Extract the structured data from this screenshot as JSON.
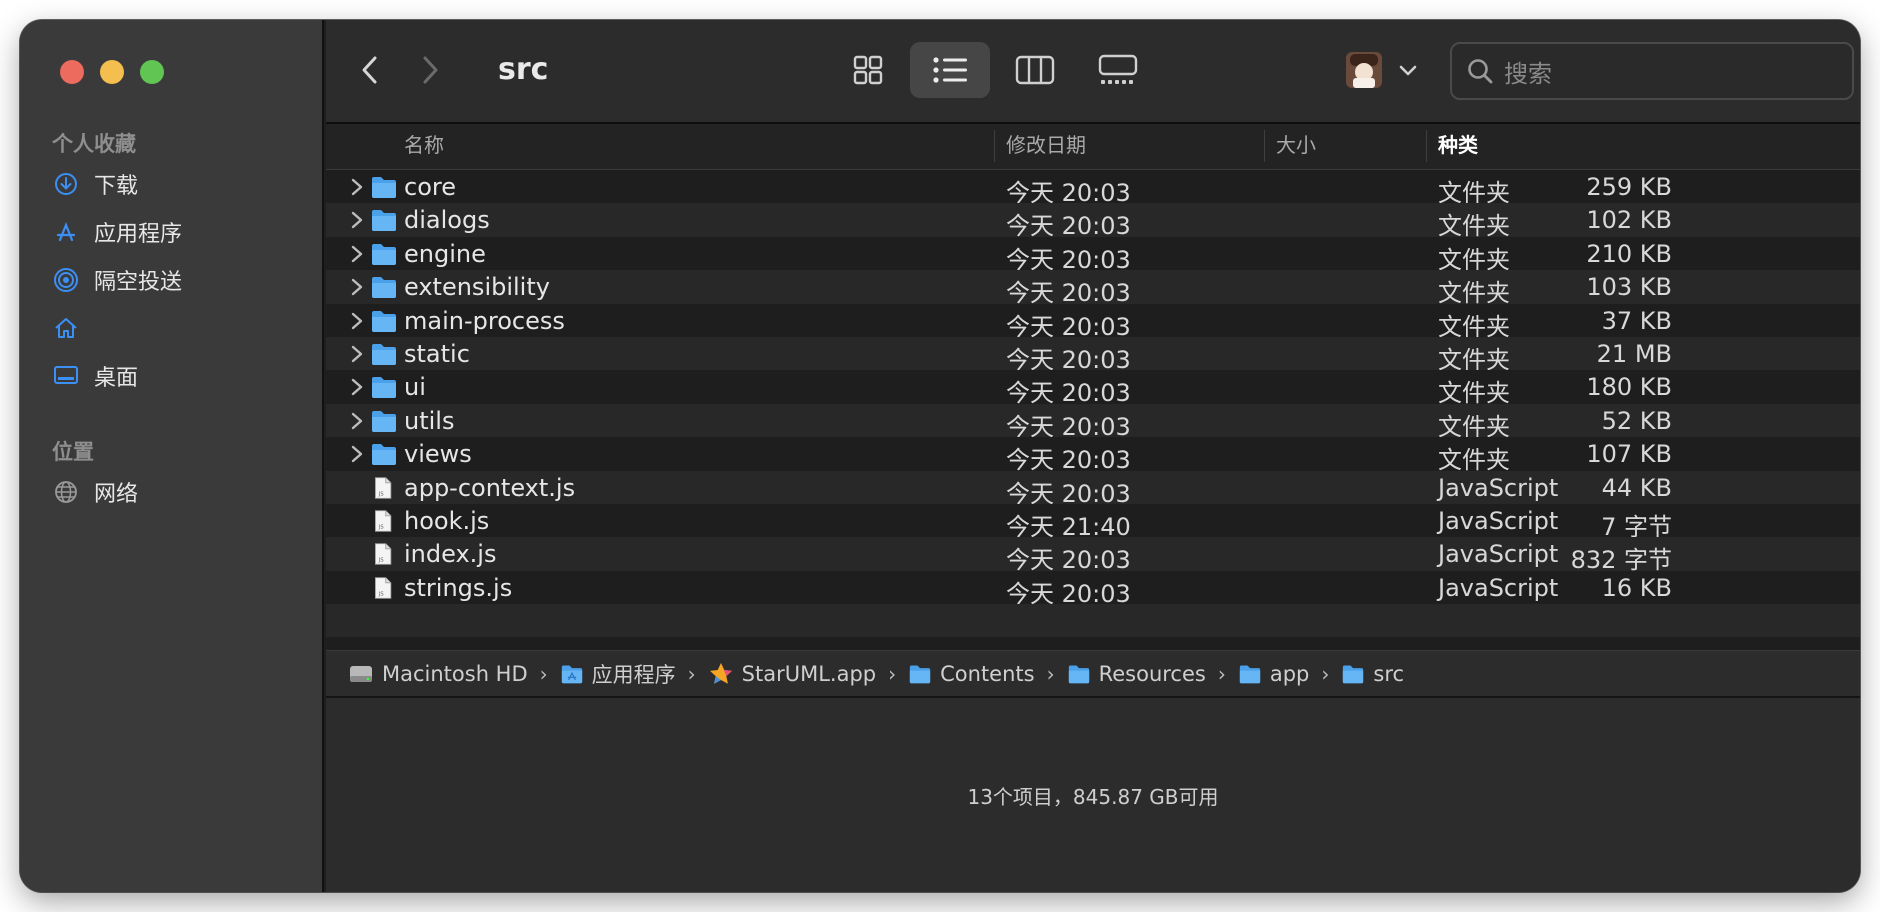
{
  "window_title": "src",
  "sidebar": {
    "favorites_title": "个人收藏",
    "favorites": [
      {
        "label": "下载",
        "icon": "download-icon"
      },
      {
        "label": "应用程序",
        "icon": "applications-icon"
      },
      {
        "label": "隔空投送",
        "icon": "airdrop-icon"
      },
      {
        "label": "",
        "icon": "home-icon"
      },
      {
        "label": "桌面",
        "icon": "desktop-icon"
      }
    ],
    "locations_title": "位置",
    "locations": [
      {
        "label": "网络",
        "icon": "network-icon"
      }
    ]
  },
  "toolbar": {
    "view_modes": [
      "icon-view",
      "list-view",
      "column-view",
      "gallery-view"
    ],
    "selected_view": "list-view",
    "search_placeholder": "搜索"
  },
  "columns": {
    "name": "名称",
    "date": "修改日期",
    "size": "大小",
    "kind": "种类"
  },
  "files": [
    {
      "name": "core",
      "date": "今天 20:03",
      "size": "259 KB",
      "kind": "文件夹",
      "type": "folder"
    },
    {
      "name": "dialogs",
      "date": "今天 20:03",
      "size": "102 KB",
      "kind": "文件夹",
      "type": "folder"
    },
    {
      "name": "engine",
      "date": "今天 20:03",
      "size": "210 KB",
      "kind": "文件夹",
      "type": "folder"
    },
    {
      "name": "extensibility",
      "date": "今天 20:03",
      "size": "103 KB",
      "kind": "文件夹",
      "type": "folder"
    },
    {
      "name": "main-process",
      "date": "今天 20:03",
      "size": "37 KB",
      "kind": "文件夹",
      "type": "folder"
    },
    {
      "name": "static",
      "date": "今天 20:03",
      "size": "21 MB",
      "kind": "文件夹",
      "type": "folder"
    },
    {
      "name": "ui",
      "date": "今天 20:03",
      "size": "180 KB",
      "kind": "文件夹",
      "type": "folder"
    },
    {
      "name": "utils",
      "date": "今天 20:03",
      "size": "52 KB",
      "kind": "文件夹",
      "type": "folder"
    },
    {
      "name": "views",
      "date": "今天 20:03",
      "size": "107 KB",
      "kind": "文件夹",
      "type": "folder"
    },
    {
      "name": "app-context.js",
      "date": "今天 20:03",
      "size": "44 KB",
      "kind": "JavaScript",
      "type": "js"
    },
    {
      "name": "hook.js",
      "date": "今天 21:40",
      "size": "7 字节",
      "kind": "JavaScript",
      "type": "js"
    },
    {
      "name": "index.js",
      "date": "今天 20:03",
      "size": "832 字节",
      "kind": "JavaScript",
      "type": "js"
    },
    {
      "name": "strings.js",
      "date": "今天 20:03",
      "size": "16 KB",
      "kind": "JavaScript",
      "type": "js"
    }
  ],
  "path": [
    {
      "label": "Macintosh HD",
      "icon": "disk-icon"
    },
    {
      "label": "应用程序",
      "icon": "folder-icon"
    },
    {
      "label": "StarUML.app",
      "icon": "staruml-app-icon"
    },
    {
      "label": "Contents",
      "icon": "folder-icon"
    },
    {
      "label": "Resources",
      "icon": "folder-icon"
    },
    {
      "label": "app",
      "icon": "folder-icon"
    },
    {
      "label": "src",
      "icon": "folder-icon"
    }
  ],
  "status": "13个项目，845.87 GB可用",
  "colors": {
    "folder_blue": "#5aaef2",
    "accent_blue": "#3b8ff5"
  }
}
